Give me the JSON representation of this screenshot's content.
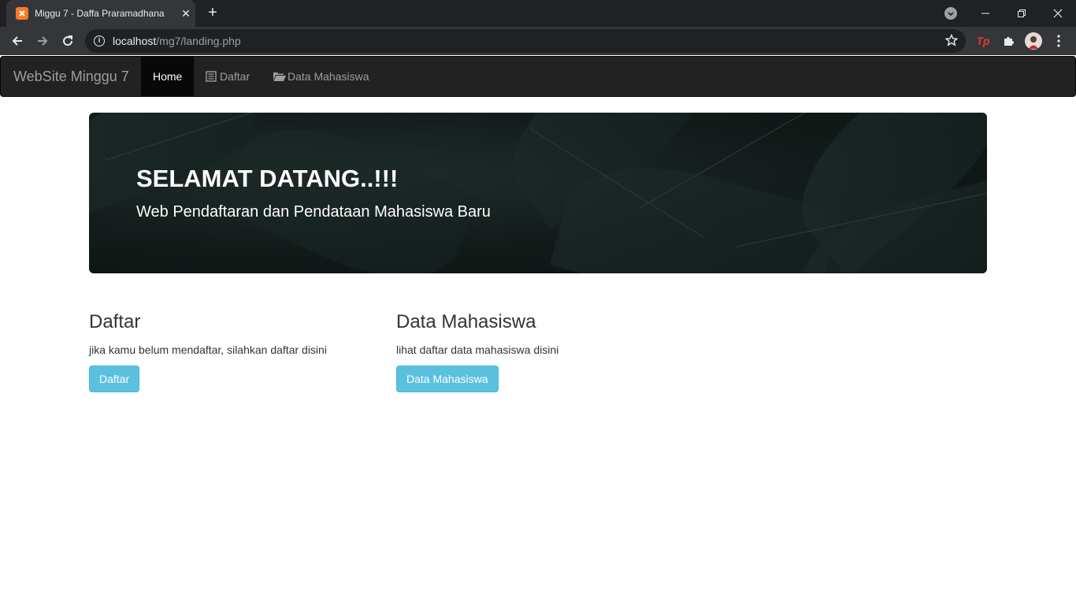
{
  "browser": {
    "tab_title": "Miggu 7 - Daffa Praramadhana",
    "url_host": "localhost",
    "url_path": "/mg7/landing.php",
    "ext_label": "Tp"
  },
  "navbar": {
    "brand": "WebSite Minggu 7",
    "items": [
      {
        "label": "Home",
        "active": true
      },
      {
        "label": "Daftar",
        "icon": "list-alt-icon"
      },
      {
        "label": "Data Mahasiswa",
        "icon": "folder-open-icon"
      }
    ]
  },
  "jumbotron": {
    "title": "SELAMAT DATANG..!!!",
    "subtitle": "Web Pendaftaran dan Pendataan Mahasiswa Baru"
  },
  "sections": [
    {
      "heading": "Daftar",
      "text": "jika kamu belum mendaftar, silahkan daftar disini",
      "button": "Daftar"
    },
    {
      "heading": "Data Mahasiswa",
      "text": "lihat daftar data mahasiswa disini",
      "button": "Data Mahasiswa"
    }
  ],
  "colors": {
    "navbar_bg": "#222222",
    "btn_info": "#5bc0de",
    "chrome_bg": "#202124"
  }
}
